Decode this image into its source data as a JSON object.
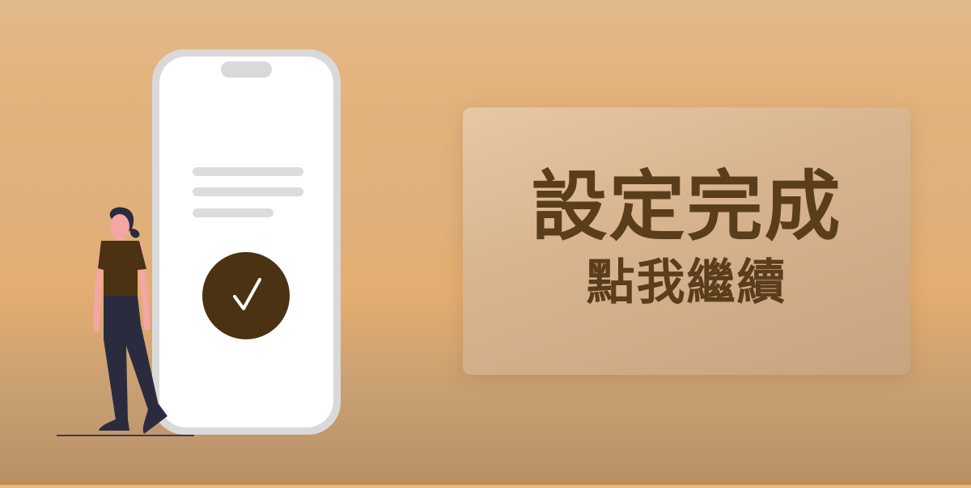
{
  "cta": {
    "title": "設定完成",
    "subtitle": "點我繼續"
  },
  "icons": {
    "check": "checkmark-icon"
  },
  "colors": {
    "accent": "#5a3e1c",
    "check_circle": "#4a3212",
    "phone_frame": "#d9d9d9",
    "background_top": "#e2b98c",
    "background_bottom": "#b89068"
  }
}
